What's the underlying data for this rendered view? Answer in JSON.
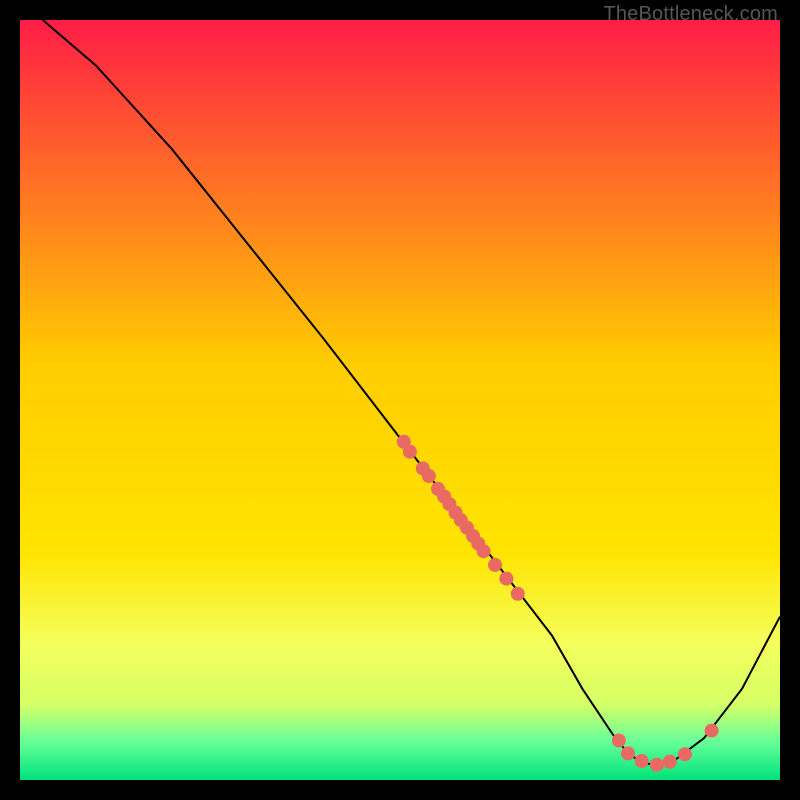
{
  "watermark": "TheBottleneck.com",
  "chart_data": {
    "type": "line",
    "title": "",
    "xlabel": "",
    "ylabel": "",
    "xlim": [
      0,
      100
    ],
    "ylim": [
      0,
      100
    ],
    "grid": false,
    "series": [
      {
        "name": "curve",
        "x": [
          3,
          10,
          20,
          30,
          40,
          50,
          55,
          60,
          65,
          70,
          74,
          78,
          80,
          82,
          84,
          86,
          90,
          95,
          100
        ],
        "y": [
          100,
          94,
          83,
          70.5,
          58,
          45,
          38.5,
          32,
          25.5,
          19,
          12,
          6,
          3.5,
          2.2,
          2,
          2.5,
          5.5,
          12,
          21.5
        ]
      }
    ],
    "points": [
      {
        "x": 50.5,
        "y": 44.5
      },
      {
        "x": 51.3,
        "y": 43.2
      },
      {
        "x": 53.0,
        "y": 41.0
      },
      {
        "x": 53.8,
        "y": 40.0
      },
      {
        "x": 55.0,
        "y": 38.3
      },
      {
        "x": 55.8,
        "y": 37.3
      },
      {
        "x": 56.5,
        "y": 36.3
      },
      {
        "x": 57.3,
        "y": 35.2
      },
      {
        "x": 58.0,
        "y": 34.2
      },
      {
        "x": 58.8,
        "y": 33.2
      },
      {
        "x": 59.6,
        "y": 32.1
      },
      {
        "x": 60.3,
        "y": 31.1
      },
      {
        "x": 61.0,
        "y": 30.1
      },
      {
        "x": 62.5,
        "y": 28.3
      },
      {
        "x": 64.0,
        "y": 26.5
      },
      {
        "x": 65.5,
        "y": 24.5
      },
      {
        "x": 78.8,
        "y": 5.2
      },
      {
        "x": 80.0,
        "y": 3.5
      },
      {
        "x": 81.8,
        "y": 2.5
      },
      {
        "x": 83.8,
        "y": 2.0
      },
      {
        "x": 85.5,
        "y": 2.4
      },
      {
        "x": 87.5,
        "y": 3.4
      },
      {
        "x": 91.0,
        "y": 6.5
      }
    ],
    "colors": {
      "gradient_top": "#ff1d46",
      "gradient_mid": "#ffe400",
      "gradient_low": "#d6ff66",
      "gradient_base1": "#66ff99",
      "gradient_base2": "#00e27a",
      "point": "#e86a62",
      "curve": "#000000"
    }
  }
}
